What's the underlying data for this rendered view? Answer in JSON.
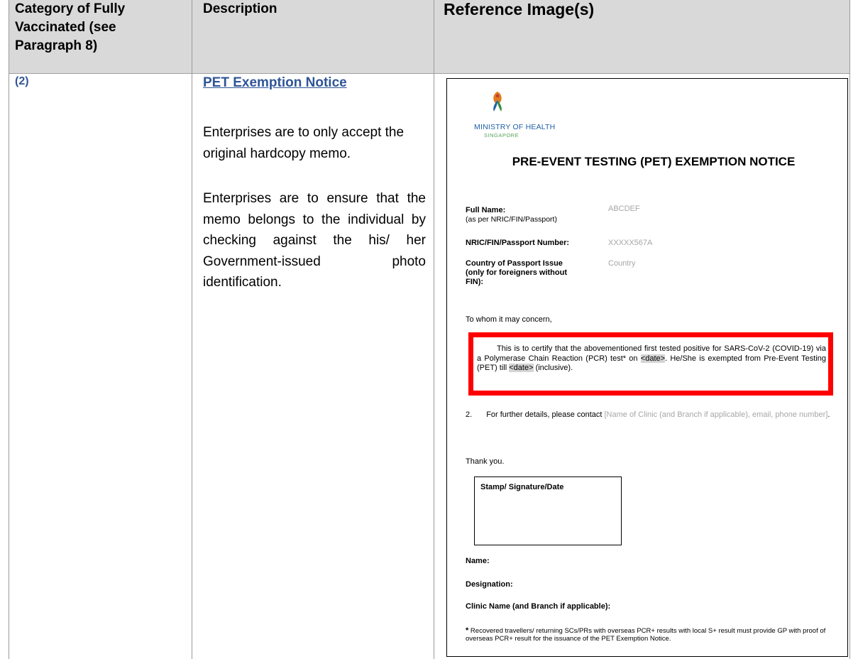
{
  "header": {
    "col1": [
      "Category of Fully",
      "Vaccinated (see",
      "Paragraph 8)"
    ],
    "col2": "Description",
    "col3": "Reference Image(s)"
  },
  "row": {
    "category": "(2)",
    "title": "PET Exemption Notice",
    "para1": "Enterprises are to only accept the original hardcopy memo.",
    "para2": "Enterprises are to ensure that the memo belongs to the individual by checking against the his/ her Government-issued photo identification."
  },
  "memo": {
    "org": "MINISTRY OF HEALTH",
    "org_sub": "SINGAPORE",
    "title": "PRE-EVENT TESTING (PET) EXEMPTION NOTICE",
    "full_name_label": "Full Name:",
    "full_name_sub": "(as per NRIC/FIN/Passport)",
    "full_name_value": "ABCDEF",
    "id_label": "NRIC/FIN/Passport Number:",
    "id_value": "XXXXX567A",
    "country_label": [
      "Country of Passport Issue",
      "(only for foreigners without",
      "FIN):"
    ],
    "country_value": "Country",
    "salutation": "To whom it may concern,",
    "cert_a": "This is to certify that the abovementioned first tested positive for SARS-CoV-2 (COVID-19) via a Polymerase Chain Reaction (PCR) test* on",
    "date1": "<date>",
    "cert_b": ". He/She is exempted from Pre-Event Testing (PET) till",
    "date2": "<date>",
    "cert_c": "(inclusive).",
    "p2_num": "2.",
    "p2_text": "For further details, please contact",
    "p2_placeholder": "[Name of Clinic (and Branch if applicable), email, phone number]",
    "p2_end": ".",
    "thanks": "Thank you.",
    "stamp_label": "Stamp/ Signature/Date",
    "name_label": "Name:",
    "designation_label": "Designation:",
    "clinic_label": "Clinic Name (and Branch if applicable):",
    "footnote_star": "*",
    "footnote": "Recovered travellers/ returning SCs/PRs with overseas PCR+ results with local S+ result must provide GP with proof of overseas PCR+ result for the issuance of the PET Exemption Notice."
  },
  "colors": {
    "header_bg": "#d9d9d9",
    "link_blue": "#2f5597",
    "highlight_red": "#ff0000"
  }
}
